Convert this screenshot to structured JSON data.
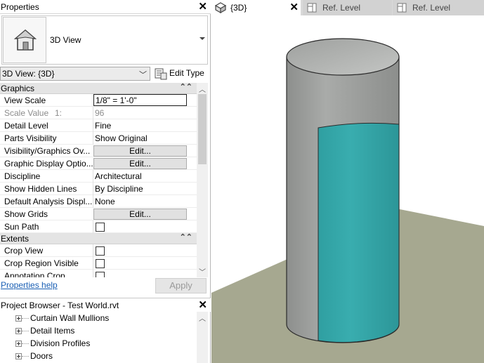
{
  "properties": {
    "title": "Properties",
    "type_name": "3D View",
    "view_selector": "3D View: {3D}",
    "edit_type_label": "Edit Type",
    "sections": [
      {
        "label": "Graphics",
        "rows": [
          {
            "key": "View Scale",
            "value": "1/8\" = 1'-0\""
          },
          {
            "key": "Scale Value",
            "sub": "1:",
            "value": "96"
          },
          {
            "key": "Detail Level",
            "value": "Fine"
          },
          {
            "key": "Parts Visibility",
            "value": "Show Original"
          },
          {
            "key": "Visibility/Graphics Ov...",
            "value": "Edit..."
          },
          {
            "key": "Graphic Display Optio...",
            "value": "Edit..."
          },
          {
            "key": "Discipline",
            "value": "Architectural"
          },
          {
            "key": "Show Hidden Lines",
            "value": "By Discipline"
          },
          {
            "key": "Default Analysis Displ...",
            "value": "None"
          },
          {
            "key": "Show Grids",
            "value": "Edit..."
          },
          {
            "key": "Sun Path",
            "checked": false
          }
        ]
      },
      {
        "label": "Extents",
        "rows": [
          {
            "key": "Crop View",
            "checked": false
          },
          {
            "key": "Crop Region Visible",
            "checked": false
          },
          {
            "key": "Annotation Crop",
            "checked": false
          }
        ]
      }
    ],
    "help_link": "Properties help",
    "apply_label": "Apply"
  },
  "project_browser": {
    "title": "Project Browser - Test World.rvt",
    "items": [
      "Curtain Wall Mullions",
      "Detail Items",
      "Division Profiles",
      "Doors"
    ]
  },
  "view_tabs": [
    {
      "label": "{3D}",
      "active": true
    },
    {
      "label": "Ref. Level",
      "active": false
    },
    {
      "label": "Ref. Level",
      "active": false
    }
  ],
  "colors": {
    "cylinder_gray": "#9a9c9a",
    "curtain_teal": "#34a7a9",
    "ground": "#a7a98f"
  },
  "icons": {
    "close": "close-icon",
    "collapse": "collapse-icon",
    "house": "house-icon",
    "view_3d": "3d-view-icon",
    "level_view": "level-view-icon",
    "expand": "plus-expand-icon"
  }
}
